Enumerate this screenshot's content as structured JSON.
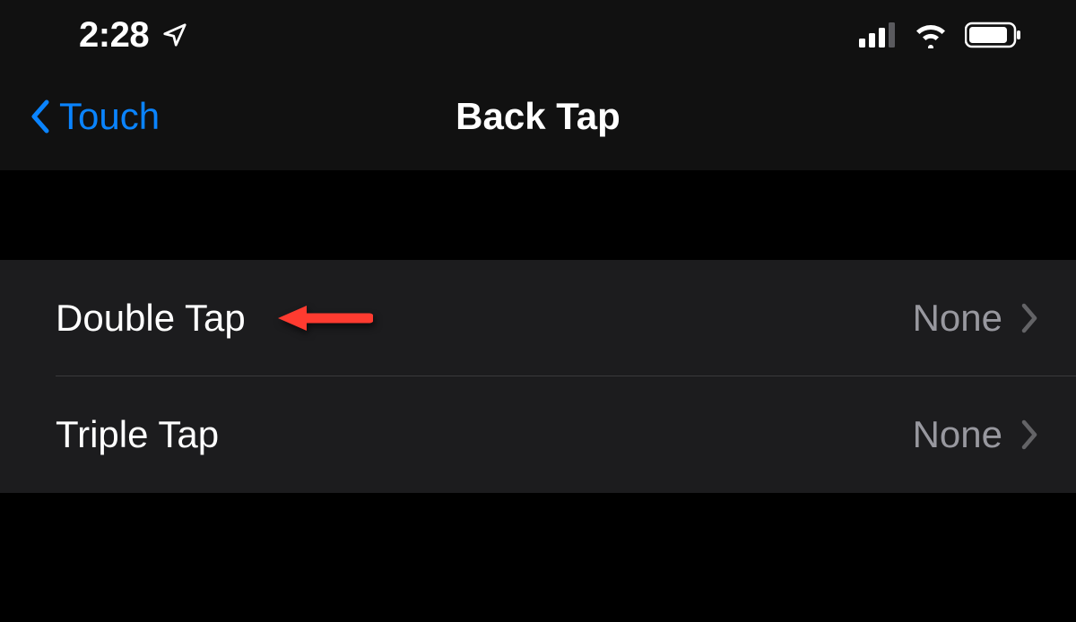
{
  "status_bar": {
    "time": "2:28"
  },
  "nav": {
    "back_label": "Touch",
    "title": "Back Tap"
  },
  "settings": {
    "rows": [
      {
        "label": "Double Tap",
        "value": "None"
      },
      {
        "label": "Triple Tap",
        "value": "None"
      }
    ]
  },
  "colors": {
    "accent": "#0a84ff",
    "annotation": "#ff3b30"
  }
}
